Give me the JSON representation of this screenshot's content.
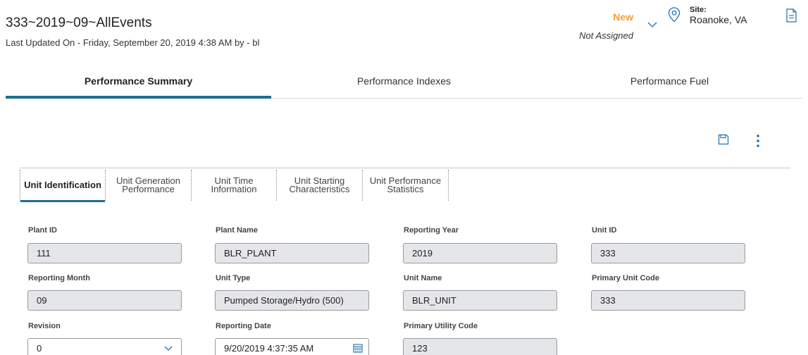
{
  "header": {
    "title": "333~2019~09~AllEvents",
    "subtitle": "Last Updated On - Friday, September 20, 2019 4:38 AM by - bl",
    "state": "New",
    "assignment": "Not Assigned",
    "site_label": "Site:",
    "site_value": "Roanoke, VA",
    "icons": {
      "state_dropdown": "chevron-down-icon",
      "site": "location-pin-icon",
      "document": "document-icon"
    }
  },
  "main_tabs": [
    {
      "label": "Performance Summary",
      "active": true
    },
    {
      "label": "Performance Indexes",
      "active": false
    },
    {
      "label": "Performance Fuel",
      "active": false
    }
  ],
  "toolbar": {
    "icons": {
      "save": "save-icon",
      "more": "more-vertical-icon"
    }
  },
  "sub_tabs": [
    {
      "label": "Unit Identification",
      "active": true
    },
    {
      "label": "Unit Generation Performance",
      "active": false
    },
    {
      "label": "Unit Time Information",
      "active": false
    },
    {
      "label": "Unit Starting Characteristics",
      "active": false
    },
    {
      "label": "Unit Performance Statistics",
      "active": false
    }
  ],
  "fields": {
    "plant_id": {
      "label": "Plant ID",
      "value": "111"
    },
    "plant_name": {
      "label": "Plant Name",
      "value": "BLR_PLANT"
    },
    "reporting_year": {
      "label": "Reporting Year",
      "value": "2019"
    },
    "unit_id": {
      "label": "Unit ID",
      "value": "333"
    },
    "reporting_month": {
      "label": "Reporting Month",
      "value": "09"
    },
    "unit_type": {
      "label": "Unit Type",
      "value": "Pumped Storage/Hydro (500)"
    },
    "unit_name": {
      "label": "Unit Name",
      "value": "BLR_UNIT"
    },
    "primary_unit_code": {
      "label": "Primary Unit Code",
      "value": "333"
    },
    "revision": {
      "label": "Revision",
      "value": "0"
    },
    "reporting_date": {
      "label": "Reporting Date",
      "value": "9/20/2019 4:37:35 AM"
    },
    "primary_utility_code": {
      "label": "Primary Utility Code",
      "value": "123"
    }
  },
  "colors": {
    "accent": "#1f6e8c",
    "state": "#f0a030",
    "icon": "#1f6fb2",
    "readonly_bg": "#e4e6e9"
  }
}
